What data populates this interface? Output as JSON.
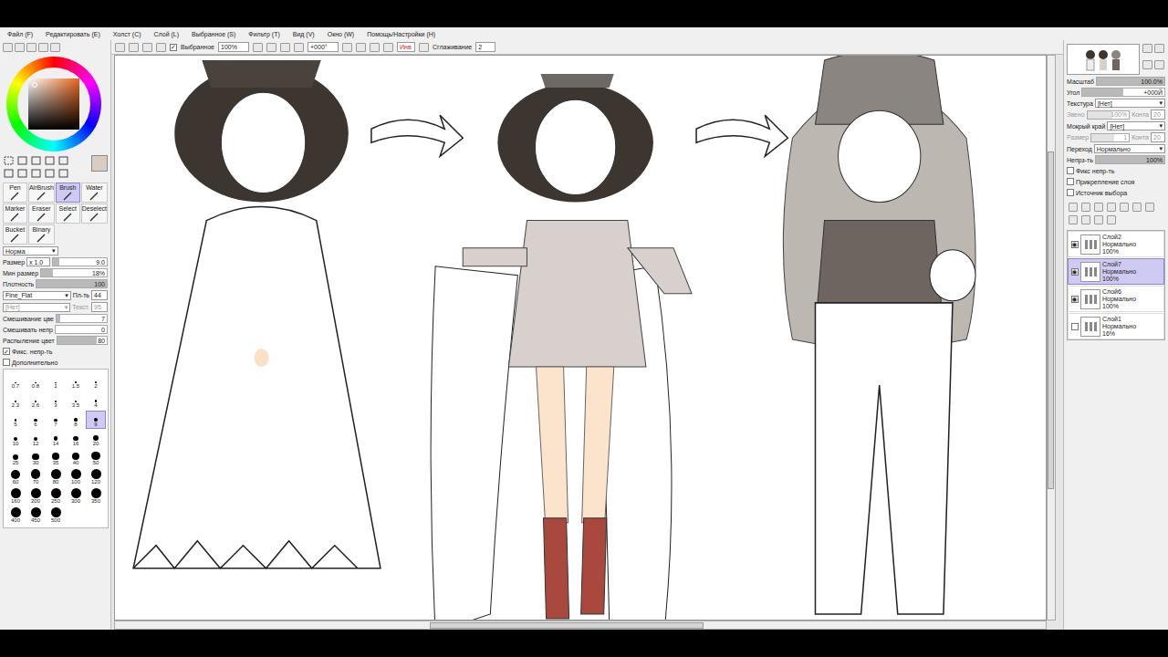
{
  "menu": [
    "Файл (F)",
    "Редактировать (E)",
    "Холст (C)",
    "Слой (L)",
    "Выбранное (S)",
    "Фильтр (T)",
    "Вид (V)",
    "Окно (W)",
    "Помощь/Настройки (H)"
  ],
  "toolbar": {
    "selection": {
      "label": "Выбранное",
      "checked": true
    },
    "zoom": "100%",
    "angle": "+000°",
    "invert": "Инв",
    "smoothing_label": "Сглаживание",
    "smoothing": "2"
  },
  "tools": [
    {
      "label": "Pen",
      "selected": false
    },
    {
      "label": "AirBrush",
      "selected": false
    },
    {
      "label": "Brush",
      "selected": true
    },
    {
      "label": "Water",
      "selected": false
    },
    {
      "label": "Marker",
      "selected": false
    },
    {
      "label": "Eraser",
      "selected": false
    },
    {
      "label": "Select",
      "selected": false
    },
    {
      "label": "Deselect",
      "selected": false
    },
    {
      "label": "Bucket",
      "selected": false
    },
    {
      "label": "Binary",
      "selected": false
    }
  ],
  "brush": {
    "mode": "Норма",
    "size": {
      "label": "Размер",
      "multiplier": "x 1.0",
      "value": "9.0",
      "level": 0.12
    },
    "sliders": [
      {
        "label": "Мин размер",
        "value": "18%",
        "level": 0.18
      },
      {
        "label": "Плотность",
        "value": "100",
        "level": 1
      }
    ],
    "texture_rows": [
      {
        "value": "Fine_Flat",
        "label": "Пл-ть",
        "reading": "44",
        "disabled": false
      },
      {
        "value": "[Нет]",
        "label": "Текст.",
        "reading": "95",
        "disabled": true
      }
    ],
    "mix_sliders": [
      {
        "label": "Смешивание цве",
        "value": "7",
        "level": 0.07
      },
      {
        "label": "Смешивать непр",
        "value": "0",
        "level": 0
      },
      {
        "label": "Распыление цвет",
        "value": "80",
        "level": 0.8
      }
    ],
    "checks": [
      {
        "label": "Фикс. непр-ть",
        "checked": true
      },
      {
        "label": "Дополнительно",
        "checked": false
      }
    ]
  },
  "sizes": [
    {
      "label": "0.7",
      "selected": false
    },
    {
      "label": "0.8",
      "selected": false
    },
    {
      "label": "1",
      "selected": false
    },
    {
      "label": "1.5",
      "selected": false
    },
    {
      "label": "2",
      "selected": false
    },
    {
      "label": "2.3",
      "selected": false
    },
    {
      "label": "2.6",
      "selected": false
    },
    {
      "label": "3",
      "selected": false
    },
    {
      "label": "3.5",
      "selected": false
    },
    {
      "label": "4",
      "selected": false
    },
    {
      "label": "5",
      "selected": false
    },
    {
      "label": "6",
      "selected": false
    },
    {
      "label": "7",
      "selected": false
    },
    {
      "label": "8",
      "selected": false
    },
    {
      "label": "9",
      "selected": true
    },
    {
      "label": "10",
      "selected": false
    },
    {
      "label": "12",
      "selected": false
    },
    {
      "label": "14",
      "selected": false
    },
    {
      "label": "16",
      "selected": false
    },
    {
      "label": "20",
      "selected": false
    },
    {
      "label": "25",
      "selected": false
    },
    {
      "label": "30",
      "selected": false
    },
    {
      "label": "35",
      "selected": false
    },
    {
      "label": "40",
      "selected": false
    },
    {
      "label": "50",
      "selected": false
    },
    {
      "label": "60",
      "selected": false
    },
    {
      "label": "70",
      "selected": false
    },
    {
      "label": "80",
      "selected": false
    },
    {
      "label": "100",
      "selected": false
    },
    {
      "label": "120",
      "selected": false
    },
    {
      "label": "160",
      "selected": false
    },
    {
      "label": "200",
      "selected": false
    },
    {
      "label": "250",
      "selected": false
    },
    {
      "label": "300",
      "selected": false
    },
    {
      "label": "350",
      "selected": false
    },
    {
      "label": "400",
      "selected": false
    },
    {
      "label": "450",
      "selected": false
    },
    {
      "label": "500",
      "selected": false
    }
  ],
  "navigator": {
    "zoom_label": "Масштаб",
    "zoom": "100.0%",
    "angle_label": "Угол",
    "angle": "+000Й"
  },
  "texture_settings": [
    {
      "kind": "select",
      "label": "Текстура",
      "value": "[Нет]",
      "disabled": false
    },
    {
      "kind": "pair",
      "label": "Звено",
      "value": "100%",
      "extra_label": "Конта",
      "extra": "20",
      "disabled": true
    },
    {
      "kind": "select",
      "label": "Мокрый край",
      "value": "[Нет]",
      "disabled": false
    },
    {
      "kind": "pair",
      "label": "Размер",
      "value": "1",
      "extra_label": "Конта",
      "extra": "20",
      "disabled": true
    }
  ],
  "blend": {
    "label": "Переход",
    "value": "Нормально"
  },
  "opacity": {
    "label": "Непрз-ть",
    "value": "100%",
    "level": 1
  },
  "layer_checks": [
    {
      "label": "Фикс непр-ть",
      "checked": false
    },
    {
      "label": "Прикрепление слоя",
      "checked": false
    },
    {
      "label": "Источник выбора",
      "checked": false
    }
  ],
  "layers": [
    {
      "name": "Слой2",
      "mode": "Нормально",
      "opacity": "100%",
      "visible": true,
      "selected": false
    },
    {
      "name": "Слой7",
      "mode": "Нормально",
      "opacity": "100%",
      "visible": true,
      "selected": true
    },
    {
      "name": "Слой6",
      "mode": "Нормально",
      "opacity": "100%",
      "visible": true,
      "selected": false
    },
    {
      "name": "Слой1",
      "mode": "Нормально",
      "opacity": "16%",
      "visible": false,
      "selected": false
    }
  ]
}
